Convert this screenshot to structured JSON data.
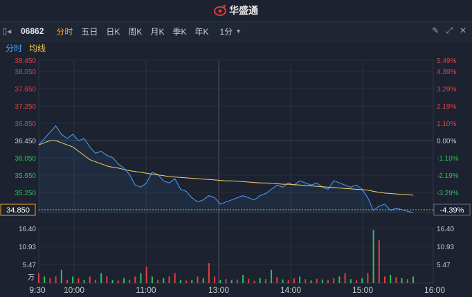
{
  "brand": {
    "name": "华盛通"
  },
  "toolbar": {
    "code": "06862",
    "tabs": [
      "分时",
      "五日",
      "日K",
      "周K",
      "月K",
      "季K",
      "年K"
    ],
    "active_tab": "分时",
    "minute": "1分"
  },
  "subbar": {
    "label1": "分时",
    "label2": "均线"
  },
  "price_axis": {
    "left_labels": [
      "38.450",
      "38.050",
      "37.650",
      "37.250",
      "36.850",
      "36.450",
      "36.050",
      "35.650",
      "35.250"
    ],
    "right_labels": [
      "5.49%",
      "4.39%",
      "3.29%",
      "2.19%",
      "1.10%",
      "0.00%",
      "-1.10%",
      "-2.19%",
      "-3.29%"
    ],
    "current_price": "34.850",
    "current_pct": "-4.39%"
  },
  "volume_axis": {
    "left_labels": [
      "16.40",
      "10.93",
      "5.47",
      "万"
    ],
    "right_labels": [
      "16.40",
      "10.93",
      "5.47"
    ]
  },
  "time_axis": [
    "9:30",
    "10:00",
    "11:00",
    "13:00",
    "14:00",
    "15:00",
    "16:00"
  ],
  "colors": {
    "price": "#4aa3ff",
    "avg": "#f5d36b",
    "up": "#e04040",
    "down": "#2fbf5f",
    "orange": "#f5a623"
  },
  "chart_data": {
    "type": "line",
    "title": "",
    "ylim": [
      34.85,
      38.45
    ],
    "price_series": [
      36.45,
      36.6,
      36.75,
      36.9,
      36.7,
      36.6,
      36.7,
      36.55,
      36.6,
      36.4,
      36.25,
      36.3,
      36.2,
      36.15,
      36.0,
      35.9,
      35.75,
      35.5,
      35.45,
      35.55,
      35.8,
      35.75,
      35.6,
      35.55,
      35.65,
      35.4,
      35.35,
      35.2,
      35.1,
      35.15,
      35.25,
      35.2,
      35.05,
      35.1,
      35.15,
      35.2,
      35.25,
      35.2,
      35.15,
      35.25,
      35.3,
      35.4,
      35.5,
      35.45,
      35.55,
      35.5,
      35.6,
      35.55,
      35.5,
      35.55,
      35.45,
      35.4,
      35.6,
      35.55,
      35.5,
      35.45,
      35.5,
      35.4,
      35.2,
      34.9,
      35.0,
      35.05,
      34.9,
      34.95,
      34.92,
      34.88,
      34.85
    ],
    "avg_series": [
      36.45,
      36.5,
      36.55,
      36.55,
      36.5,
      36.45,
      36.4,
      36.3,
      36.2,
      36.1,
      36.05,
      36.0,
      35.95,
      35.92,
      35.9,
      35.87,
      35.84,
      35.82,
      35.8,
      35.78,
      35.76,
      35.74,
      35.72,
      35.7,
      35.69,
      35.68,
      35.67,
      35.66,
      35.65,
      35.64,
      35.63,
      35.62,
      35.61,
      35.6,
      35.6,
      35.59,
      35.58,
      35.57,
      35.56,
      35.55,
      35.55,
      35.54,
      35.53,
      35.52,
      35.52,
      35.51,
      35.5,
      35.49,
      35.48,
      35.47,
      35.46,
      35.45,
      35.44,
      35.43,
      35.42,
      35.41,
      35.4,
      35.39,
      35.38,
      35.35,
      35.33,
      35.31,
      35.3,
      35.29,
      35.28,
      35.27,
      35.26
    ],
    "volume_max": 16.4,
    "volume_unit": "万",
    "volumes": [
      3,
      2,
      1.5,
      2,
      4,
      1,
      2,
      1.5,
      1,
      2,
      1,
      3,
      2,
      1,
      0.8,
      1.5,
      1,
      2,
      3,
      5,
      2,
      1,
      1.5,
      2,
      3,
      1,
      0.8,
      1,
      2,
      1.5,
      6,
      2,
      1,
      1.2,
      0.9,
      1.1,
      2.5,
      1.3,
      0.7,
      1.5,
      1.2,
      4,
      1.8,
      1.1,
      0.9,
      1.4,
      2,
      1.2,
      0.8,
      1.3,
      1.1,
      0.9,
      1.5,
      2,
      3,
      1.2,
      0.9,
      1.5,
      3,
      16,
      13,
      2,
      2.5,
      1.8,
      1.5,
      1.2,
      2
    ],
    "volume_dirs": [
      1,
      0,
      1,
      1,
      0,
      1,
      0,
      1,
      0,
      1,
      1,
      0,
      1,
      0,
      1,
      0,
      1,
      1,
      0,
      1,
      0,
      1,
      0,
      1,
      1,
      0,
      1,
      0,
      1,
      0,
      1,
      1,
      0,
      1,
      0,
      1,
      0,
      1,
      1,
      0,
      1,
      0,
      1,
      0,
      1,
      1,
      0,
      1,
      0,
      1,
      0,
      1,
      1,
      0,
      1,
      0,
      1,
      0,
      1,
      0,
      1,
      1,
      0,
      1,
      0,
      1,
      0
    ]
  }
}
